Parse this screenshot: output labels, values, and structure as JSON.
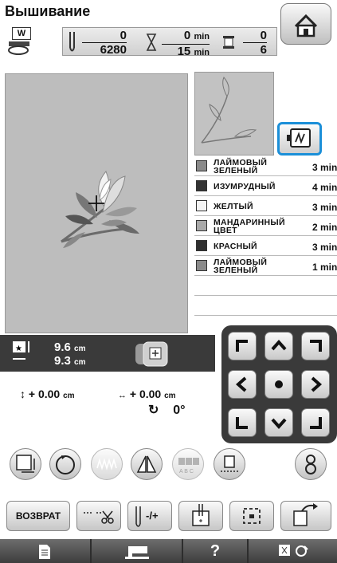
{
  "header": {
    "title": "Вышивание",
    "foot_code": "W"
  },
  "status": {
    "stitch_current": "0",
    "stitch_total": "6280",
    "time_current": "0",
    "time_total": "15",
    "time_unit": "min",
    "color_current": "0",
    "color_total": "6"
  },
  "threads": [
    {
      "name": "ЛАЙМОВЫЙ\nЗЕЛЕНЫЙ",
      "time": "3 min",
      "color": "#8a8a8a"
    },
    {
      "name": "ИЗУМРУДНЫЙ",
      "time": "4 min",
      "color": "#333333"
    },
    {
      "name": "ЖЕЛТЫЙ",
      "time": "3 min",
      "color": "#f4f4f4"
    },
    {
      "name": "МАНДАРИННЫЙ\nЦВЕТ",
      "time": "2 min",
      "color": "#a9a9a9"
    },
    {
      "name": "КРАСНЫЙ",
      "time": "3 min",
      "color": "#2f2f2f"
    },
    {
      "name": "ЛАЙМОВЫЙ\nЗЕЛЕНЫЙ",
      "time": "1 min",
      "color": "#8a8a8a"
    }
  ],
  "size": {
    "width_value": "9.6",
    "height_value": "9.3",
    "unit": "cm"
  },
  "position": {
    "vertical_value": "+ 0.00",
    "horizontal_value": "+ 0.00",
    "unit": "cm",
    "angle": "0°"
  },
  "buttons": {
    "return_label": "ВОЗВРАТ",
    "tension_label": "-/+",
    "help_label": "?"
  },
  "icons": [
    "home-icon",
    "presser-foot-icon",
    "needle-icon",
    "hourglass-icon",
    "thread-spool-icon",
    "zoom-view-icon",
    "pattern-size-icon",
    "frame-icon",
    "vertical-move-icon",
    "horizontal-move-icon",
    "rotate-icon",
    "arrow-up-icon",
    "arrow-down-icon",
    "arrow-left-icon",
    "arrow-right-icon",
    "center-dot-icon",
    "corner-top-left-icon",
    "corner-top-right-icon",
    "corner-bottom-left-icon",
    "corner-bottom-right-icon",
    "resize-icon",
    "rotate-button-icon",
    "density-icon",
    "mirror-icon",
    "letter-array-icon",
    "single-color-icon",
    "border-icon",
    "thread-cutting-icon",
    "needle-tension-icon",
    "starting-point-icon",
    "trial-icon",
    "frame-back-icon",
    "page-icon",
    "machine-icon",
    "settings-icon"
  ]
}
